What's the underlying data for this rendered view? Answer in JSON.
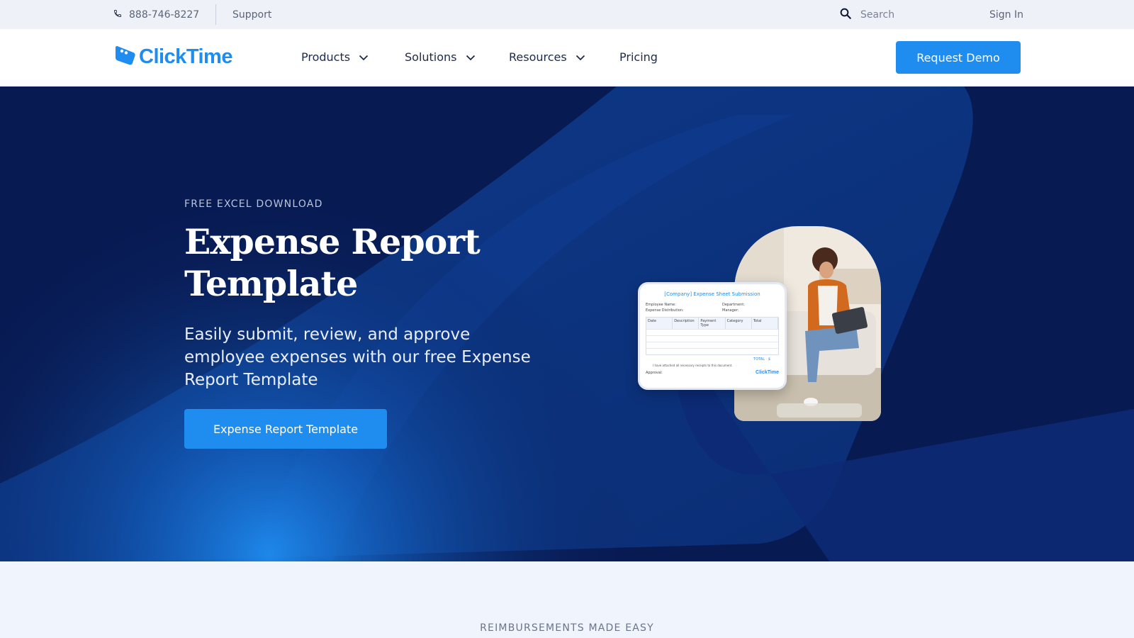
{
  "utility_bar": {
    "phone": "888-746-8227",
    "support": "Support",
    "search_placeholder": "Search",
    "sign_in": "Sign In"
  },
  "nav": {
    "logo_text": "ClickTime",
    "items": [
      {
        "label": "Products",
        "has_dropdown": true
      },
      {
        "label": "Solutions",
        "has_dropdown": true
      },
      {
        "label": "Resources",
        "has_dropdown": true
      },
      {
        "label": "Pricing",
        "has_dropdown": false
      }
    ],
    "cta": "Request Demo"
  },
  "hero": {
    "eyebrow": "FREE EXCEL DOWNLOAD",
    "title": "Expense Report Template",
    "subtitle": "Easily submit, review, and approve employee expenses with our free Expense Report Template",
    "cta": "Expense Report Template",
    "sheet": {
      "title": "[Company] Expense Sheet Submission",
      "employee_name": "Employee Name:",
      "department": "Department:",
      "expense_distribution": "Expense Distribution:",
      "manager": "Manager:",
      "columns": [
        "Date",
        "Description",
        "Payment Type",
        "Category",
        "Total"
      ],
      "total_label": "TOTAL",
      "total_value": "$",
      "note": "I have attached all necessary receipts to this document.",
      "approval": "Approval:",
      "logo": "ClickTime"
    }
  },
  "lower": {
    "eyebrow": "REIMBURSEMENTS MADE EASY"
  },
  "colors": {
    "brand_blue": "#1f8cf0",
    "hero_navy": "#0a1e5a",
    "utility_bg": "#eef1f7",
    "section_bg": "#f0f4fc"
  },
  "icons": {
    "phone": "phone-icon",
    "search": "search-icon",
    "dropdown": "chevron-down-icon",
    "logo": "clicktime-logo-icon"
  }
}
